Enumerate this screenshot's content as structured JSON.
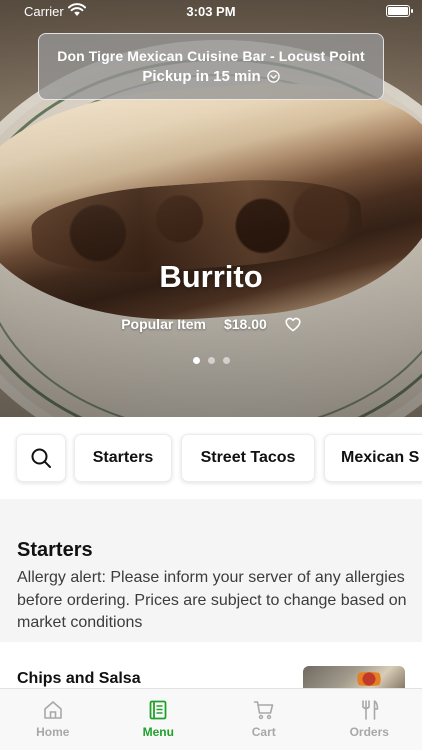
{
  "status_bar": {
    "carrier": "Carrier",
    "time": "3:03 PM"
  },
  "restaurant": {
    "name": "Don Tigre Mexican Cuisine Bar - Locust Point",
    "pickup": "Pickup in 15 min"
  },
  "hero": {
    "title": "Burrito",
    "tag": "Popular Item",
    "price": "$18.00",
    "carousel_pages": 3,
    "active_page": 1
  },
  "categories": {
    "chips": [
      "Starters",
      "Street Tacos",
      "Mexican S"
    ]
  },
  "section": {
    "title": "Starters",
    "note": "Allergy alert: Please inform your server of any allergies before ordering. Prices are subject to change based on market conditions"
  },
  "items": [
    {
      "name": "Chips and Salsa"
    }
  ],
  "tabs": [
    {
      "label": "Home",
      "icon": "home-icon",
      "active": false
    },
    {
      "label": "Menu",
      "icon": "menu-icon",
      "active": true
    },
    {
      "label": "Cart",
      "icon": "cart-icon",
      "active": false
    },
    {
      "label": "Orders",
      "icon": "fork-knife-icon",
      "active": false
    }
  ],
  "colors": {
    "accent": "#1fa12b",
    "tab_inactive": "#a8a8a8"
  }
}
